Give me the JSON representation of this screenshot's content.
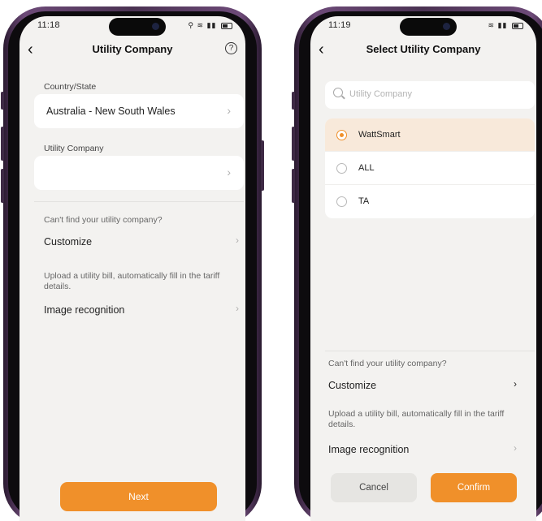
{
  "left_screen": {
    "status": {
      "time": "11:18"
    },
    "nav": {
      "title": "Utility Company"
    },
    "country_state": {
      "label": "Country/State",
      "value": "Australia - New South Wales"
    },
    "utility_company": {
      "label": "Utility Company",
      "value": ""
    },
    "help_text": "Can't find your utility company?",
    "customize": {
      "label": "Customize"
    },
    "upload_text": "Upload a utility bill, automatically fill in the tariff details.",
    "image_recognition": {
      "label": "Image recognition"
    },
    "next_button": "Next"
  },
  "right_screen": {
    "status": {
      "time": "11:19"
    },
    "nav": {
      "title": "Select Utility Company"
    },
    "search": {
      "placeholder": "Utility Company"
    },
    "options": [
      {
        "label": "WattSmart",
        "selected": true
      },
      {
        "label": "ALL",
        "selected": false
      },
      {
        "label": "TA",
        "selected": false
      }
    ],
    "help_text": "Can't find your utility company?",
    "customize": {
      "label": "Customize"
    },
    "upload_text": "Upload a utility bill, automatically fill in the tariff details.",
    "image_recognition": {
      "label": "Image recognition"
    },
    "cancel_button": "Cancel",
    "confirm_button": "Confirm"
  },
  "icons": {
    "back": "chevron-left-icon",
    "help": "question-circle-icon",
    "chevron": "chevron-right-icon",
    "search": "search-icon"
  },
  "colors": {
    "accent": "#f0902a",
    "selected_row": "#f8e9da",
    "screen_bg": "#f3f2f0",
    "frame": "#4a3252"
  }
}
